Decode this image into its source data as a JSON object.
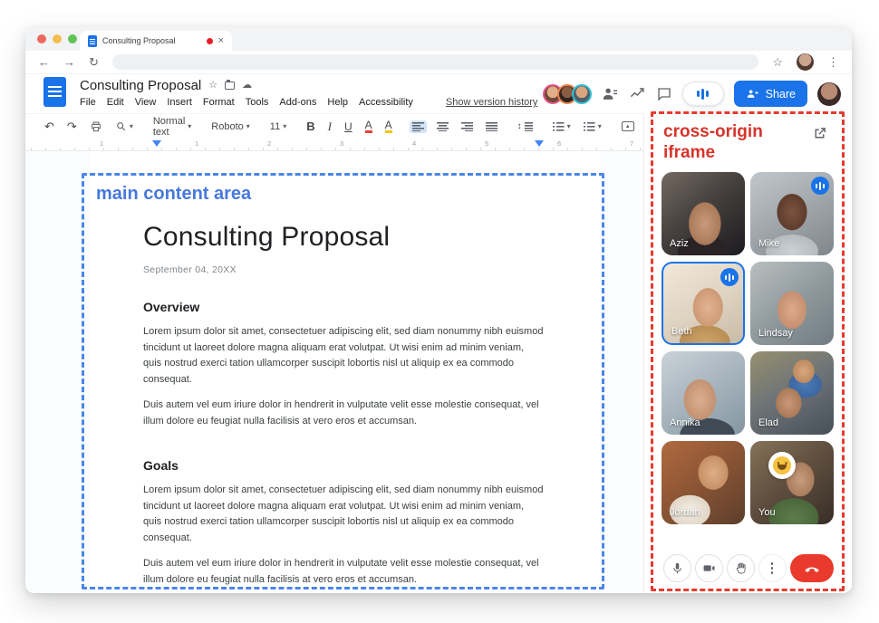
{
  "icons": {
    "back": "←",
    "forward": "→",
    "reload": "↻",
    "star": "☆",
    "kebab": "⋮",
    "close": "×",
    "undo": "↶",
    "redo": "↷",
    "dropdown": "▾",
    "bold": "B",
    "italic": "I",
    "underline": "U",
    "text_color": "A",
    "highlight": "A",
    "pencil": "✎",
    "line_spacing": "↕",
    "image_marker": "▲",
    "title_star": "☆",
    "cloud": "☁"
  },
  "browser": {
    "tab_title": "Consulting Proposal"
  },
  "docs": {
    "title": "Consulting Proposal",
    "menu": [
      "File",
      "Edit",
      "View",
      "Insert",
      "Format",
      "Tools",
      "Add-ons",
      "Help",
      "Accessibility"
    ],
    "version_history": "Show version history",
    "share": "Share",
    "toolbar": {
      "style": "Normal text",
      "font": "Roboto",
      "size": "11"
    },
    "ruler": [
      "1",
      "1",
      "2",
      "3",
      "4",
      "5",
      "6",
      "7"
    ]
  },
  "document": {
    "title": "Consulting Proposal",
    "date": "September 04, 20XX",
    "sections": [
      {
        "heading": "Overview",
        "p1": "Lorem ipsum dolor sit amet, consectetuer adipiscing elit, sed diam nonummy nibh euismod tincidunt ut laoreet dolore magna aliquam erat volutpat. Ut wisi enim ad minim veniam, quis nostrud exerci tation ullamcorper suscipit lobortis nisl ut aliquip ex ea commodo consequat.",
        "p2": "Duis autem vel eum iriure dolor in hendrerit in vulputate velit esse molestie consequat, vel illum dolore eu feugiat nulla facilisis at vero eros et accumsan."
      },
      {
        "heading": "Goals",
        "p1": "Lorem ipsum dolor sit amet, consectetuer adipiscing elit, sed diam nonummy nibh euismod tincidunt ut laoreet dolore magna aliquam erat volutpat. Ut wisi enim ad minim veniam, quis nostrud exerci tation ullamcorper suscipit lobortis nisl ut aliquip ex ea commodo consequat.",
        "p2": "Duis autem vel eum iriure dolor in hendrerit in vulputate velit esse molestie consequat, vel illum dolore eu feugiat nulla facilisis at vero eros et accumsan."
      }
    ]
  },
  "annotations": {
    "main": "main content area",
    "iframe": "cross-origin iframe"
  },
  "meet": {
    "participants": [
      {
        "name": "Aziz",
        "style": "background:radial-gradient(ellipse 30px 40px at 52% 62%,#c79a7c 0%,#aa7a58 58%,rgba(0,0,0,0) 60%),radial-gradient(ellipse 40px 26px at 50% 96%,#2a2326 0%,#2a2326 70%,rgba(0,0,0,0) 71%),linear-gradient(140deg,#756a62 0%,#46413f 45%,#1c1b1f 100%)"
      },
      {
        "name": "Mike",
        "style": "background:radial-gradient(ellipse 28px 34px at 50% 48%,#7b5340 0%,#5e3d2c 58%,rgba(0,0,0,0) 60%),radial-gradient(ellipse 44px 28px at 50% 95%,#ccd2d6 0%,#b4bcc1 65%,rgba(0,0,0,0) 66%),linear-gradient(150deg,#c2c7cb 0%,#9aa1a6 60%,#7e868c 100%)"
      },
      {
        "name": "Beth",
        "style": "background:radial-gradient(ellipse 28px 36px at 56% 55%,#e2b392 0%,#cd9a75 58%,rgba(0,0,0,0) 60%),radial-gradient(ellipse 46px 30px at 52% 98%,#caa36b 0%,#b98e55 60%,rgba(0,0,0,0) 61%),linear-gradient(150deg,#f1e9dc 0%,#ded2c0 55%,#c9bba6 100%)"
      },
      {
        "name": "Lindsay",
        "style": "background:radial-gradient(ellipse 27px 35px at 50% 58%,#dcaa8a 0%,#c69070 58%,rgba(0,0,0,0) 60%),linear-gradient(140deg,#b9bfc0 0%,#8d979b 55%,#707c82 100%)"
      },
      {
        "name": "Annika",
        "style": "background:radial-gradient(ellipse 30px 38px at 46% 58%,#dcae90 0%,#c39272 58%,rgba(0,0,0,0) 60%),radial-gradient(ellipse 50px 30px at 55% 100%,#3f4a55 0%,#3f4a55 60%,rgba(0,0,0,0) 61%),linear-gradient(145deg,#c9d2d8 0%,#a3b1ba 55%,#8496a1 100%)"
      },
      {
        "name": "Elad",
        "style": "background:radial-gradient(ellipse 24px 28px at 46% 62%,#c9987a 0%,#aa7a58 58%,rgba(0,0,0,0) 60%),radial-gradient(ellipse 20px 22px at 64% 24%,#d9a87e 0%,#bd8a5e 58%,rgba(0,0,0,0) 60%),radial-gradient(ellipse 30px 24px at 66% 40%,#4a7ab8 0%,#3c66a0 60%,rgba(0,0,0,0) 61%),linear-gradient(150deg,#97906f 0%,#6b7277 50%,#474f58 100%)"
      },
      {
        "name": "Jordan",
        "style": "background:radial-gradient(ellipse 28px 32px at 62% 38%,#deae87 0%,#c69066 58%,rgba(0,0,0,0) 60%),radial-gradient(ellipse 36px 28px at 34% 84%,#f4efe6 0%,#e0d6c6 62%,rgba(0,0,0,0) 63%),linear-gradient(140deg,#b06a40 0%,#8a5434 50%,#5c3f2c 100%)"
      },
      {
        "name": "You",
        "style": "background:radial-gradient(ellipse 26px 32px at 60% 46%,#c89d7e 0%,#a87c5c 58%,rgba(0,0,0,0) 60%),radial-gradient(ellipse 44px 34px at 52% 92%,#5d7c49 0%,#4a673c 62%,rgba(0,0,0,0) 63%),linear-gradient(140deg,#857258 0%,#5d4d3e 50%,#372e27 100%)"
      }
    ]
  },
  "colors": {
    "accent_blue": "#1a73e8",
    "annotation_blue": "#4a86e8",
    "annotation_red": "#e63a2e",
    "end_call_red": "#ea3a2d"
  }
}
